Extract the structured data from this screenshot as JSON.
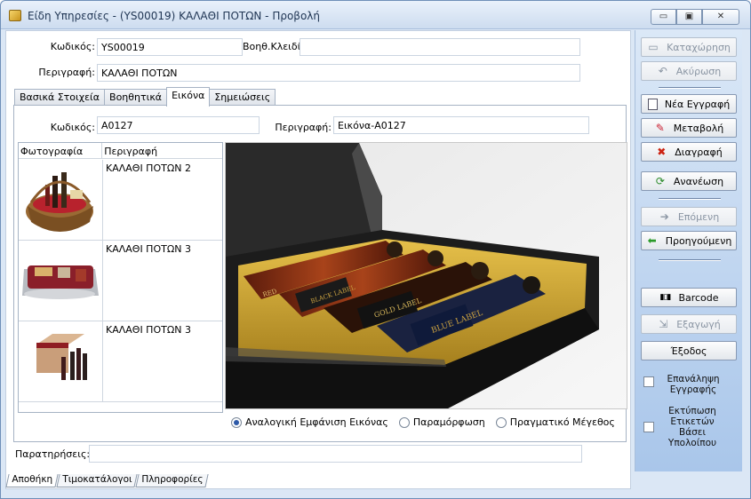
{
  "window": {
    "title": "Είδη Υπηρεσίες - (YS00019) ΚΑΛΑΘΙ ΠΟΤΩΝ -  Προβολή",
    "minimize": "▭",
    "maximize": "▣",
    "close": "✕"
  },
  "header": {
    "code_label": "Κωδικός:",
    "code_value": "YS00019",
    "aux_key_label": "Βοηθ.Κλειδί:",
    "aux_key_value": "",
    "description_label": "Περιγραφή:",
    "description_value": "ΚΑΛΑΘΙ ΠΟΤΩΝ"
  },
  "tabs": [
    {
      "label": "Βασικά Στοιχεία"
    },
    {
      "label": "Βοηθητικά"
    },
    {
      "label": "Εικόνα"
    },
    {
      "label": "Σημειώσεις"
    }
  ],
  "image_tab": {
    "code_label": "Κωδικός:",
    "code_value": "A0127",
    "description_label": "Περιγραφή:",
    "description_value": "Εικόνα-A0127",
    "table": {
      "col_photo": "Φωτογραφία",
      "col_description": "Περιγραφή",
      "rows": [
        {
          "description": "ΚΑΛΑΘΙ ΠΟΤΩΝ 2"
        },
        {
          "description": "ΚΑΛΑΘΙ ΠΟΤΩΝ 3"
        },
        {
          "description": "ΚΑΛΑΘΙ ΠΟΤΩΝ 3"
        }
      ]
    },
    "display_options": [
      {
        "label": "Αναλογική Εμφάνιση Εικόνας",
        "selected": true
      },
      {
        "label": "Παραμόρφωση",
        "selected": false
      },
      {
        "label": "Πραγματικό Μέγεθος",
        "selected": false
      }
    ],
    "bottle_labels": [
      "BLUE LABEL",
      "GOLD LABEL",
      "BLACK LABEL",
      "RED"
    ]
  },
  "notes": {
    "label": "Παρατηρήσεις:",
    "value": ""
  },
  "bottom_tabs": [
    {
      "label": "Αποθήκη"
    },
    {
      "label": "Τιμοκατάλογοι"
    },
    {
      "label": "Πληροφορίες"
    }
  ],
  "sidebar": {
    "save": "Καταχώρηση",
    "cancel": "Ακύρωση",
    "new_record": "Νέα Εγγραφή",
    "edit": "Μεταβολή",
    "delete": "Διαγραφή",
    "refresh": "Ανανέωση",
    "next": "Επόμενη",
    "previous": "Προηγούμενη",
    "barcode": "Barcode",
    "export": "Εξαγωγή",
    "exit": "Έξοδος",
    "repeat_record": "Επανάληψη Εγγραφής",
    "print_labels": "Εκτύπωση Ετικετών Βάσει Υπολοίπου"
  },
  "colors": {
    "accent": "#2e5aa8",
    "sidebar_top": "#dbe8f7",
    "sidebar_bottom": "#a9c6ea"
  }
}
